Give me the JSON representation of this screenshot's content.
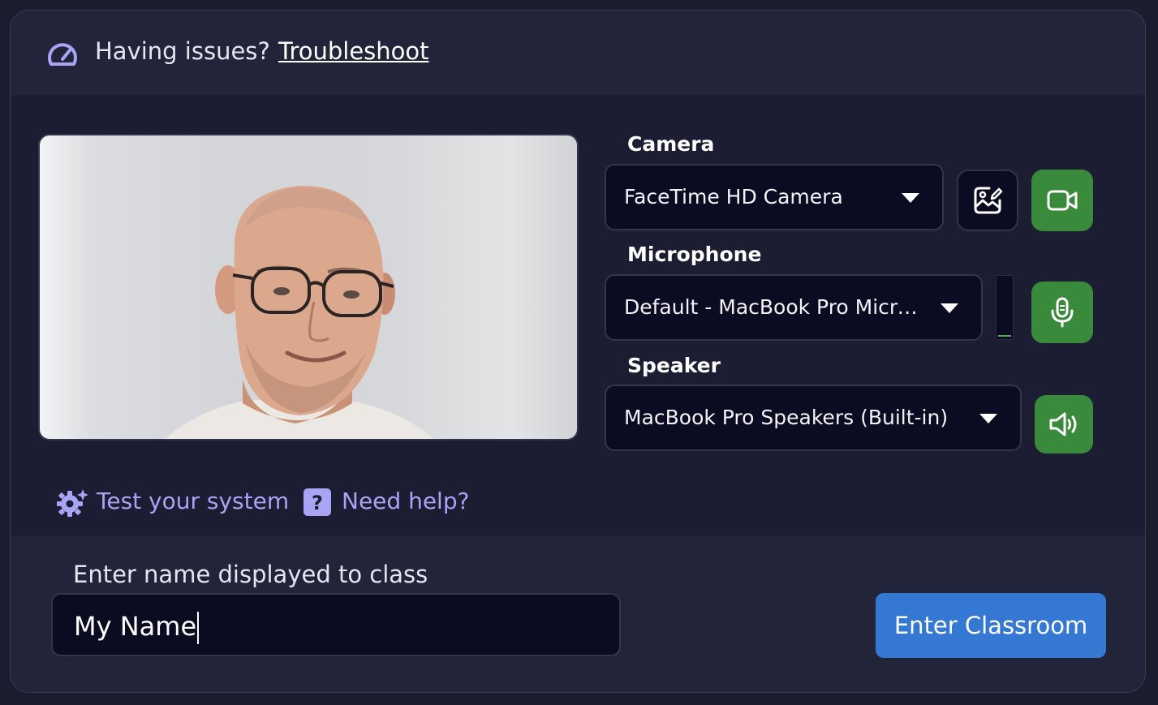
{
  "header": {
    "issues_text": "Having issues?",
    "troubleshoot_link": "Troubleshoot"
  },
  "devices": {
    "camera": {
      "label": "Camera",
      "selected": "FaceTime HD Camera"
    },
    "microphone": {
      "label": "Microphone",
      "selected": "Default - MacBook Pro Microphone (Built-in)",
      "level": 0.02
    },
    "speaker": {
      "label": "Speaker",
      "selected": "MacBook Pro Speakers (Built-in)"
    }
  },
  "links": {
    "test_system": "Test your system",
    "need_help": "Need help?"
  },
  "name_entry": {
    "label": "Enter name displayed to class",
    "value": "My Name"
  },
  "enter_button": "Enter Classroom",
  "icons": {
    "header": "speedometer-icon",
    "camera_effects": "image-edit-icon",
    "camera_toggle": "video-camera-icon",
    "mic_toggle": "microphone-icon",
    "speaker_toggle": "speaker-icon",
    "test_system": "gear-sparkle-icon",
    "need_help": "question-icon"
  },
  "colors": {
    "accent_purple": "#a9a4f3",
    "toggle_green": "#3a8a3c",
    "primary_blue": "#3478d4",
    "panel_bg": "#1c1d33"
  }
}
